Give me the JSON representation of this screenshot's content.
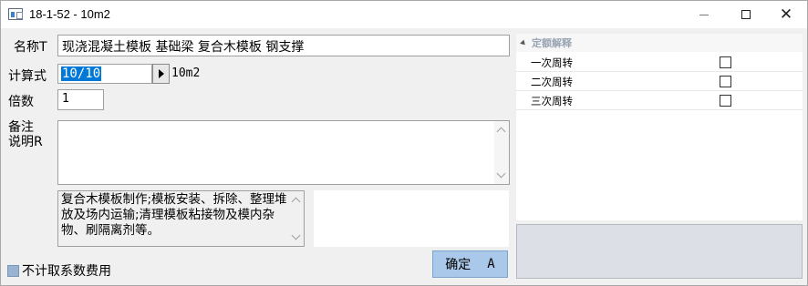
{
  "window": {
    "title": "18-1-52 - 10m2",
    "controls": {
      "minimize_icon": "minimize-icon",
      "maximize_icon": "maximize-icon",
      "close_icon": "close-icon"
    }
  },
  "form": {
    "name_label": "名称T",
    "name_value": "现浇混凝土模板 基础梁 复合木模板 钢支撑",
    "formula_label": "计算式",
    "formula_value": "10/10",
    "formula_unit": "10m2",
    "multiplier_label": "倍数",
    "multiplier_value": "1",
    "remark_label_line1": "备注",
    "remark_label_line2": "说明R",
    "remark_value": "",
    "work_content": "复合木模板制作;模板安装、拆除、整理堆放及场内运输;清理模板粘接物及模内杂物、刷隔离剂等。",
    "exclude_coefficient_label": "不计取系数费用",
    "ok_label": "确定",
    "ok_shortcut": "A"
  },
  "quota_panel": {
    "header": "定额解释",
    "rows": [
      {
        "label": "一次周转",
        "checked": false
      },
      {
        "label": "二次周转",
        "checked": false
      },
      {
        "label": "三次周转",
        "checked": false
      }
    ]
  },
  "colors": {
    "selection": "#0078d7",
    "ok_button": "#aac9ea",
    "help_panel": "#dcdfe6",
    "checkbox_blue": "#99b4d1"
  }
}
